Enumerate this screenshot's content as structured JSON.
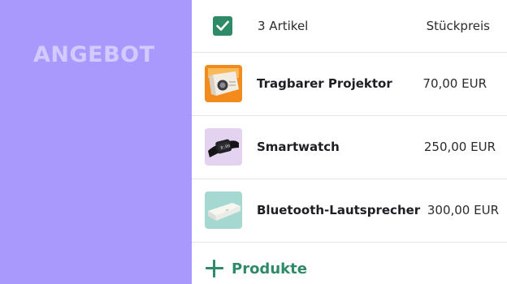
{
  "sidebar": {
    "title": "ANGEBOT"
  },
  "header": {
    "count_label": "3 Artikel",
    "price_label": "Stückpreis",
    "checkbox_checked": true
  },
  "items": [
    {
      "name": "Tragbarer Projektor",
      "price": "70,00 EUR",
      "thumb": "projector-image"
    },
    {
      "name": "Smartwatch",
      "price": "250,00 EUR",
      "thumb": "smartwatch-image"
    },
    {
      "name": "Bluetooth-Lautsprecher",
      "price": "300,00 EUR",
      "thumb": "speaker-image"
    }
  ],
  "add_button": {
    "label": "Produkte",
    "icon": "plus-icon"
  },
  "colors": {
    "sidebar": "#a999fd",
    "sidebar_text": "#d3cbff",
    "accent": "#2f8a68",
    "divider": "#e3e3e8"
  }
}
